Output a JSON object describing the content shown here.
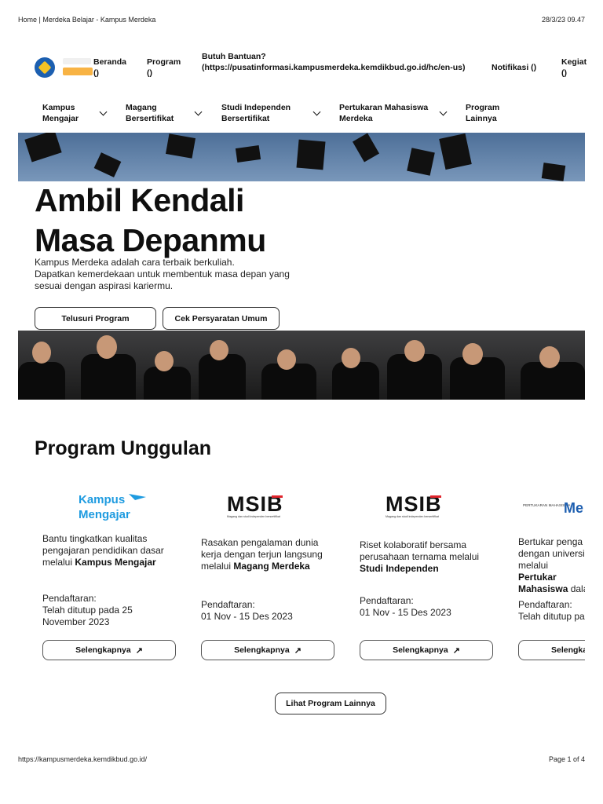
{
  "browser": {
    "tab_title": "Home | Merdeka Belajar - Kampus Merdeka",
    "timestamp": "28/3/23 09.47",
    "url": "https://kampusmerdeka.kemdikbud.go.id/",
    "page_indicator": "Page 1 of 4"
  },
  "topnav": {
    "beranda": "Beranda ()",
    "program": "Program ()",
    "bantuan": "Butuh Bantuan? (https://pusatinformasi.kampusmerdeka.kemdikbud.go.id/hc/en-us)",
    "notifikasi": "Notifikasi ()",
    "kegiatan": "Kegiat ()"
  },
  "mainnav": [
    {
      "label": "Kampus Mengajar"
    },
    {
      "label": "Magang Bersertifikat"
    },
    {
      "label": "Studi Independen Bersertifikat"
    },
    {
      "label": "Pertukaran Mahasiswa Merdeka"
    },
    {
      "label": "Program Lainnya"
    }
  ],
  "hero": {
    "title_line1": "Ambil Kendali",
    "title_line2": "Masa Depanmu",
    "desc_line1": "Kampus Merdeka adalah cara terbaik berkuliah.",
    "desc_line2": "Dapatkan kemerdekaan untuk membentuk masa depan yang sesuai dengan aspirasi kariermu.",
    "btn_telusuri": "Telusuri Program",
    "btn_cek": "Cek Persyaratan Umum"
  },
  "program": {
    "title": "Program Unggulan",
    "more_button": "Lihat Program Lainnya",
    "cards": [
      {
        "logo_text_1": "Kampus",
        "logo_text_2": "Mengajar",
        "desc_pre": "Bantu tingkatkan kualitas pengajaran pendidikan dasar melalui ",
        "desc_bold": "Kampus Mengajar",
        "desc_post": "",
        "reg_label": "Pendaftaran:",
        "reg_value": "Telah ditutup pada 25 November 2023",
        "button": "Selengkapnya"
      },
      {
        "logo_text_1": "MSIB",
        "logo_text_2": "Magang dan studi independen bersertifikat",
        "desc_pre": "Rasakan pengalaman dunia kerja dengan terjun langsung melalui ",
        "desc_bold": "Magang Merdeka",
        "desc_post": "",
        "reg_label": "Pendaftaran:",
        "reg_value": "01 Nov - 15 Des 2023",
        "button": "Selengkapnya"
      },
      {
        "logo_text_1": "MSIB",
        "logo_text_2": "Magang dan studi independen bersertifikat",
        "desc_pre": "Riset kolaboratif bersama perusahaan ternama melalui ",
        "desc_bold": "Studi Independen",
        "desc_post": "",
        "reg_label": "Pendaftaran:",
        "reg_value": "01 Nov - 15 Des 2023",
        "button": "Selengkapnya"
      },
      {
        "logo_text_1": "PERTUKARAN MAHASISWA",
        "logo_text_2": "Me",
        "desc_pre": "Bertukar penga dengan universi melalui ",
        "desc_bold": "Pertukar Mahasiswa",
        "desc_post": " dala",
        "reg_label": "Pendaftaran:",
        "reg_value": "Telah ditutup pa",
        "button": "Selengka"
      }
    ]
  },
  "colors": {
    "kampus_mengajar_blue": "#1e9be0",
    "msib_red": "#e0242c",
    "text_dark": "#111111"
  }
}
